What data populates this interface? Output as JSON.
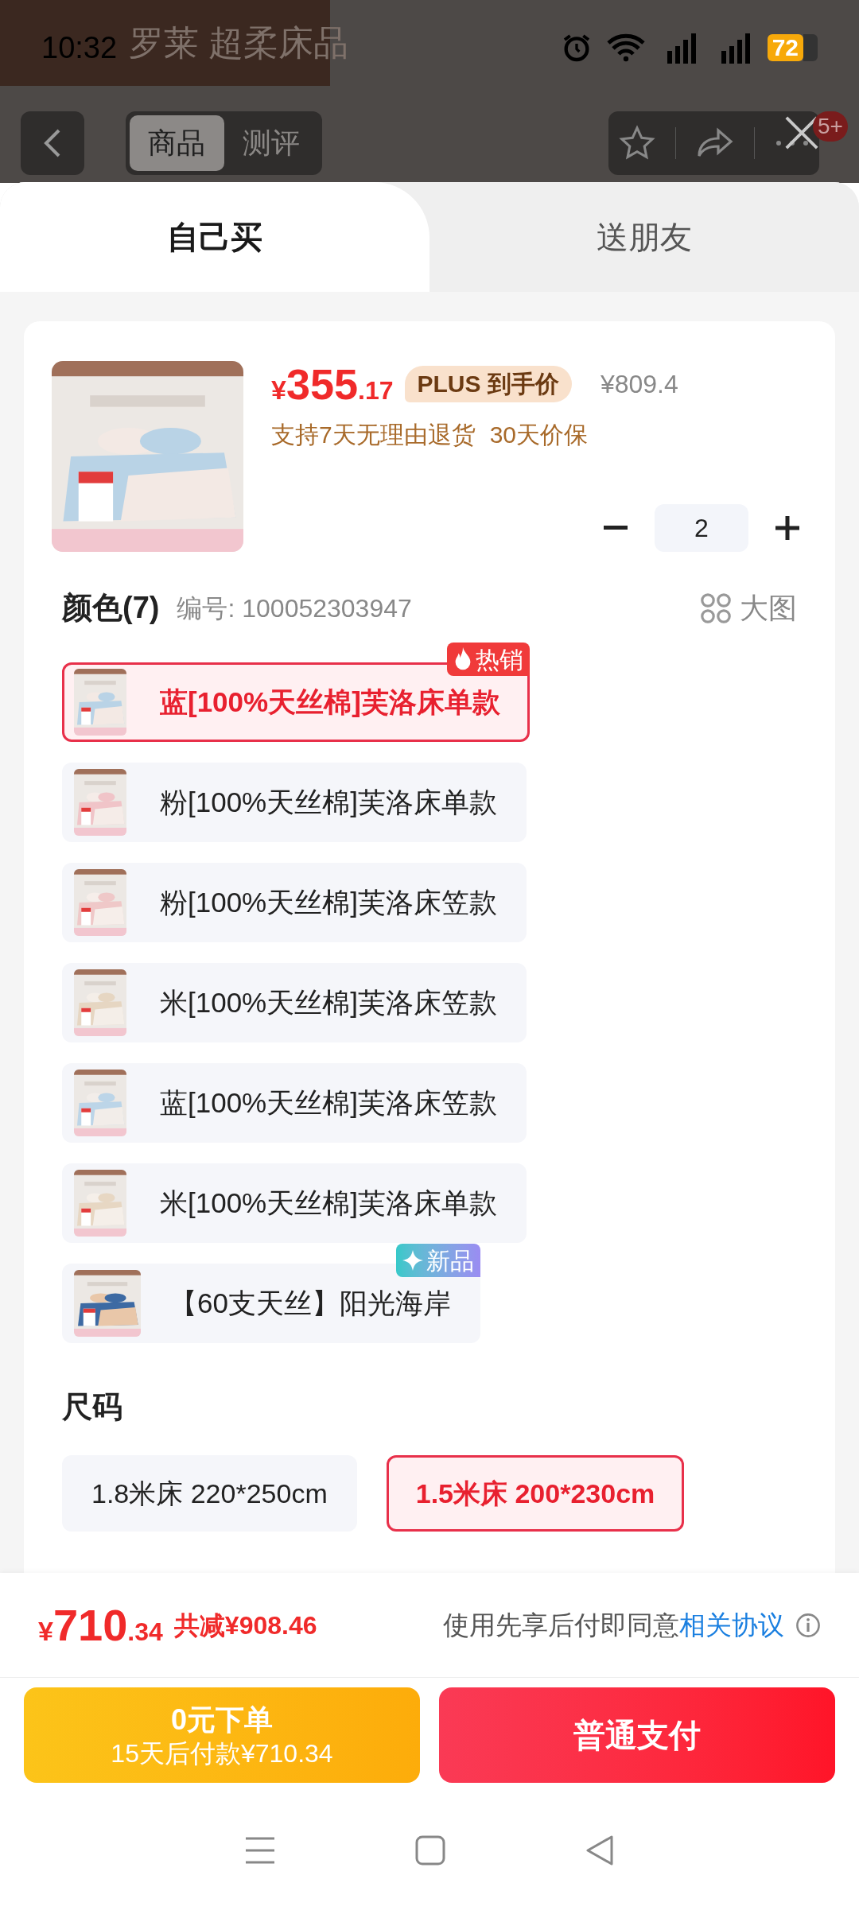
{
  "status_bar": {
    "time": "10:32",
    "battery": "72"
  },
  "brand_banner": {
    "name": "罗莱 超柔床品"
  },
  "nav": {
    "tabs": [
      {
        "label": "商品",
        "selected": true
      },
      {
        "label": "测评",
        "selected": false
      }
    ],
    "badge": "5+"
  },
  "sheet_tabs": [
    {
      "label": "自己买",
      "selected": true
    },
    {
      "label": "送朋友",
      "selected": false
    }
  ],
  "product": {
    "currency": "¥",
    "price_int": "355",
    "price_dec": ".17",
    "price_tag": "PLUS 到手价",
    "original_price": "¥809.4",
    "services": [
      "支持7天无理由退货",
      "30天价保"
    ],
    "quantity": "2"
  },
  "color_section": {
    "title": "颜色(7)",
    "sku": "编号: 100052303947",
    "big_view": "大图",
    "options": [
      {
        "label": "蓝[100%天丝棉]芙洛床单款",
        "selected": true,
        "badge": {
          "text": "热销",
          "kind": "hot"
        }
      },
      {
        "label": "粉[100%天丝棉]芙洛床单款",
        "selected": false
      },
      {
        "label": "粉[100%天丝棉]芙洛床笠款",
        "selected": false
      },
      {
        "label": "米[100%天丝棉]芙洛床笠款",
        "selected": false
      },
      {
        "label": "蓝[100%天丝棉]芙洛床笠款",
        "selected": false
      },
      {
        "label": "米[100%天丝棉]芙洛床单款",
        "selected": false
      },
      {
        "label": "【60支天丝】阳光海岸",
        "selected": false,
        "badge": {
          "text": "新品",
          "kind": "new"
        }
      }
    ]
  },
  "size_section": {
    "title": "尺码",
    "options": [
      {
        "label": "1.8米床 220*250cm",
        "selected": false
      },
      {
        "label": "1.5米床 200*230cm",
        "selected": true
      }
    ]
  },
  "footer": {
    "currency": "¥",
    "total_int": "710",
    "total_dec": ".34",
    "discount": "共减¥908.46",
    "agreement": "使用先享后付即同意",
    "agreement_link": "相关协议",
    "pay_later": {
      "title": "0元下单",
      "subtitle": "15天后付款¥710.34"
    },
    "pay_now": "普通支付"
  }
}
